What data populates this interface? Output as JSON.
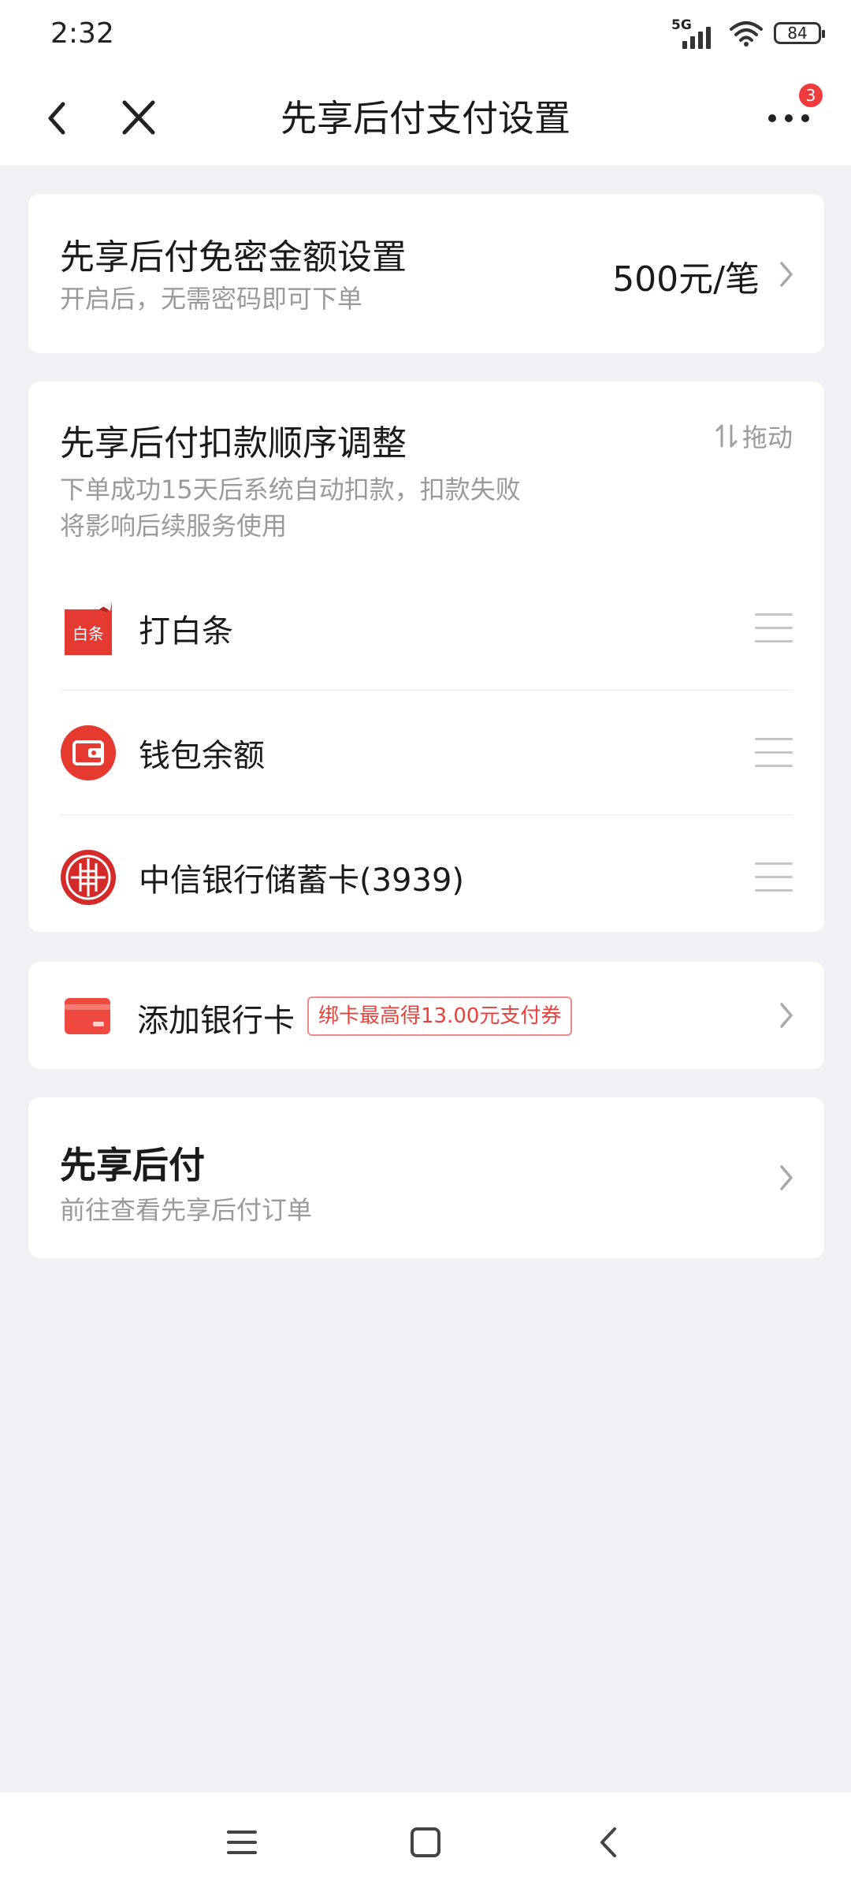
{
  "status_bar": {
    "time": "2:32",
    "network": "5G",
    "battery": "84"
  },
  "header": {
    "title": "先享后付支付设置",
    "more_badge_count": "3",
    "icons": [
      "back-arrow-icon",
      "close-icon",
      "more-dots-icon"
    ]
  },
  "free_password": {
    "title": "先享后付免密金额设置",
    "subtitle": "开启后，无需密码即可下单",
    "value": "500元/笔"
  },
  "deduction_order": {
    "title": "先享后付扣款顺序调整",
    "drag_hint": "拖动",
    "description_line1": "下单成功15天后系统自动扣款，扣款失败",
    "description_line2": "将影响后续服务使用",
    "methods": [
      {
        "label": "打白条",
        "icon": "baitiao-icon",
        "icon_text": "白条"
      },
      {
        "label": "钱包余额",
        "icon": "wallet-icon"
      },
      {
        "label": "中信银行储蓄卡(3939)",
        "icon": "citic-bank-icon"
      }
    ]
  },
  "add_card": {
    "label": "添加银行卡",
    "promo": "绑卡最高得13.00元支付券"
  },
  "pay_later": {
    "title": "先享后付",
    "subtitle": "前往查看先享后付订单"
  },
  "colors": {
    "brand_red": "#e8413c",
    "background": "#f1f1f5",
    "gray_text": "#9a9a9a"
  }
}
